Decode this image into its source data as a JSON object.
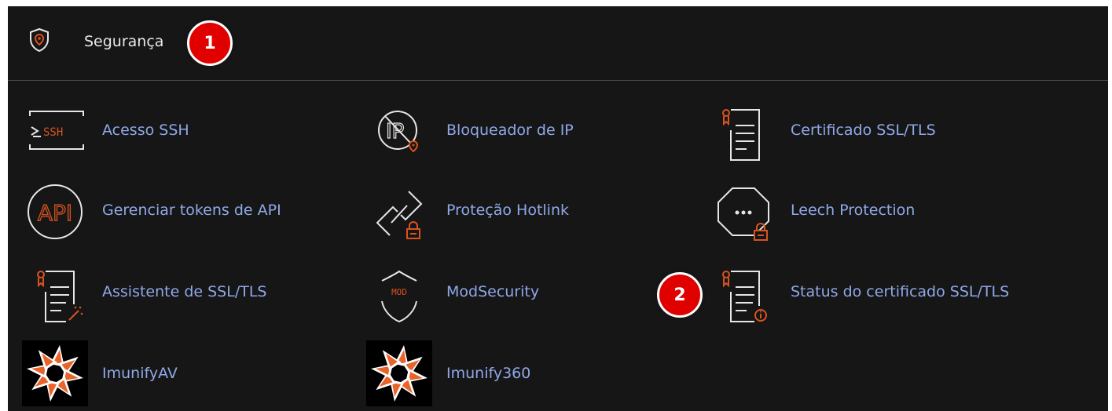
{
  "header": {
    "title": "Segurança",
    "icon": "shield-location-icon",
    "badge": "1"
  },
  "items": [
    {
      "label": "Acesso SSH",
      "icon": "ssh-terminal-icon"
    },
    {
      "label": "Bloqueador de IP",
      "icon": "ip-blocker-icon"
    },
    {
      "label": "Certificado SSL/TLS",
      "icon": "certificate-icon"
    },
    {
      "label": "Gerenciar tokens de API",
      "icon": "api-icon"
    },
    {
      "label": "Proteção Hotlink",
      "icon": "hotlink-chain-lock-icon"
    },
    {
      "label": "Leech Protection",
      "icon": "leech-octagon-lock-icon"
    },
    {
      "label": "Assistente de SSL/TLS",
      "icon": "certificate-wizard-icon"
    },
    {
      "label": "ModSecurity",
      "icon": "modsecurity-shield-icon"
    },
    {
      "label": "Status do certificado SSL/TLS",
      "icon": "certificate-status-icon",
      "badge": "2"
    },
    {
      "label": "ImunifyAV",
      "icon": "imunify-logo-icon"
    },
    {
      "label": "Imunify360",
      "icon": "imunify-logo-icon"
    }
  ],
  "ssh_icon_text": "SSH",
  "api_icon_text": "API",
  "ip_icon_text": "IP",
  "mod_icon_text": "MOD",
  "colors": {
    "background": "#161616",
    "link": "#8fa8e8",
    "accent_orange": "#d9531e",
    "icon_stroke": "#e6e6e6",
    "badge_red": "#e00000"
  }
}
